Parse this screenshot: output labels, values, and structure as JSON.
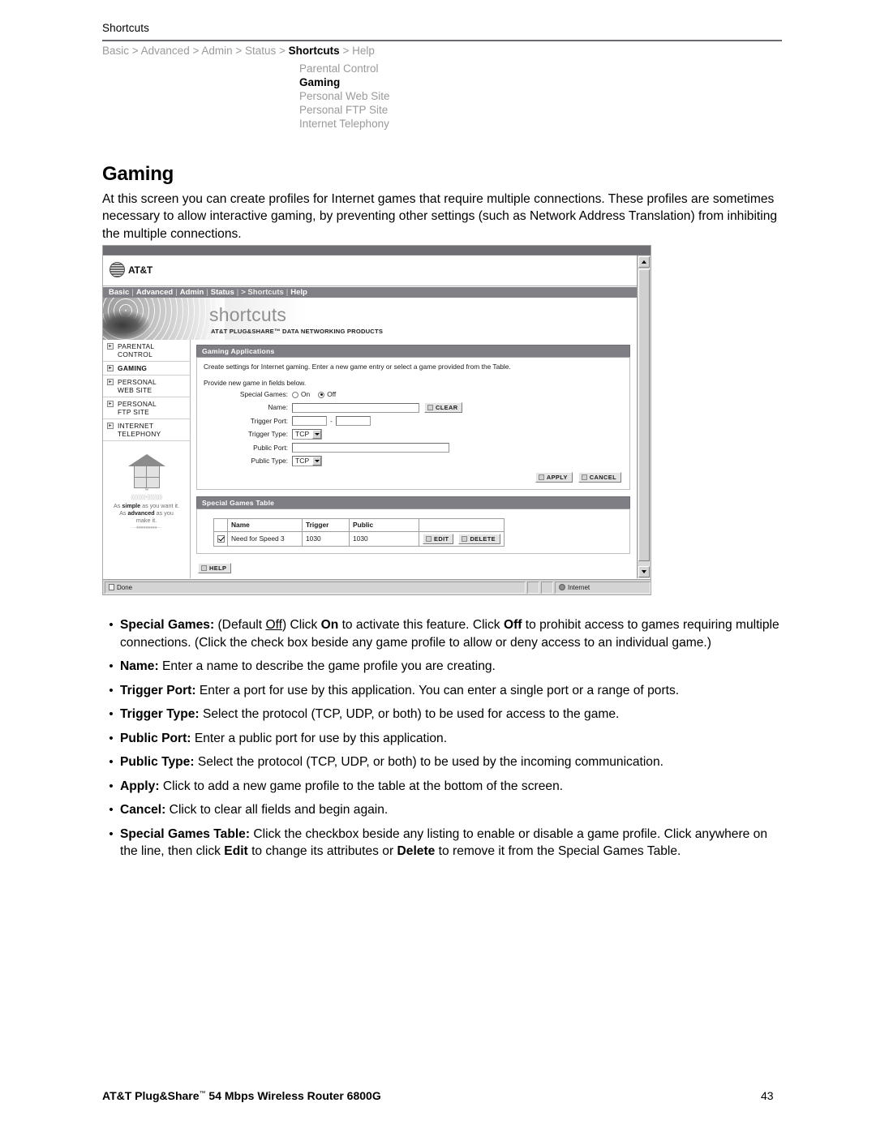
{
  "document": {
    "running_head": "Shortcuts",
    "breadcrumb": {
      "items": [
        "Basic",
        "Advanced",
        "Admin",
        "Status",
        "Shortcuts",
        "Help"
      ],
      "current": "Shortcuts",
      "separator": ">"
    },
    "sub_nav": {
      "items": [
        "Parental Control",
        "Gaming",
        "Personal Web Site",
        "Personal FTP Site",
        "Internet Telephony"
      ],
      "current": "Gaming"
    },
    "title": "Gaming",
    "intro": "At this screen you can create profiles for Internet games that require multiple connections. These profiles are sometimes necessary to allow interactive gaming, by preventing other settings (such as Network Address Translation) from inhibiting the multiple connections.",
    "footer": {
      "left": "AT&T Plug&Share",
      "left_tm": "™",
      "left_rest": " 54 Mbps Wireless Router 6800G",
      "page_number": "43"
    }
  },
  "screenshot": {
    "brand": {
      "logo_text": "AT&T",
      "banner_word": "shortcuts",
      "banner_subtitle": "AT&T PLUG&SHARE™ DATA NETWORKING PRODUCTS"
    },
    "nav": {
      "items": [
        "Basic",
        "Advanced",
        "Admin",
        "Status",
        "> Shortcuts",
        "Help"
      ],
      "current": "> Shortcuts"
    },
    "sidebar": {
      "items": [
        {
          "label_line1": "PARENTAL",
          "label_line2": "CONTROL",
          "current": false
        },
        {
          "label_line1": "GAMING",
          "label_line2": "",
          "current": true
        },
        {
          "label_line1": "PERSONAL",
          "label_line2": "WEB SITE",
          "current": false
        },
        {
          "label_line1": "PERSONAL",
          "label_line2": "FTP SITE",
          "current": false
        },
        {
          "label_line1": "INTERNET",
          "label_line2": "TELEPHONY",
          "current": false
        }
      ],
      "tagline_line1_pre": "As ",
      "tagline_line1_bold": "simple",
      "tagline_line1_post": " as you want it.",
      "tagline_line2_pre": "As ",
      "tagline_line2_bold": "advanced",
      "tagline_line2_post": " as you make it.",
      "tm": "™"
    },
    "applications_panel": {
      "heading": "Gaming Applications",
      "description": "Create settings for Internet gaming. Enter a new game entry or select a game provided from the Table.",
      "lead": "Provide new game in fields below.",
      "fields": {
        "special_games_label": "Special Games:",
        "special_games_on": "On",
        "special_games_off": "Off",
        "special_games_value": "Off",
        "name_label": "Name:",
        "name_value": "",
        "clear_button": "CLEAR",
        "trigger_port_label": "Trigger Port:",
        "trigger_port_from": "",
        "trigger_port_to": "",
        "trigger_port_dash": "-",
        "trigger_type_label": "Trigger Type:",
        "trigger_type_value": "TCP",
        "public_port_label": "Public Port:",
        "public_port_value": "",
        "public_type_label": "Public Type:",
        "public_type_value": "TCP"
      },
      "apply_button": "APPLY",
      "cancel_button": "CANCEL"
    },
    "games_table": {
      "heading": "Special Games Table",
      "columns": [
        "",
        "Name",
        "Trigger",
        "Public",
        ""
      ],
      "rows": [
        {
          "checked": true,
          "name": "Need for Speed 3",
          "trigger": "1030",
          "public": "1030",
          "edit_button": "EDIT",
          "delete_button": "DELETE"
        }
      ]
    },
    "help_button": "HELP",
    "status_bar": {
      "left": "Done",
      "zone": "Internet"
    }
  },
  "bullets": [
    {
      "term": "Special Games:",
      "parts": [
        {
          "t": " (Default "
        },
        {
          "t": "Off",
          "style": "u"
        },
        {
          "t": ") Click "
        },
        {
          "t": "On",
          "style": "b"
        },
        {
          "t": " to activate this feature. Click "
        },
        {
          "t": "Off",
          "style": "b"
        },
        {
          "t": " to prohibit access to games requiring multiple connections. (Click the check box beside any game profile to allow or deny access to an individual game.)"
        }
      ]
    },
    {
      "term": "Name:",
      "parts": [
        {
          "t": " Enter a name to describe the game profile you are creating."
        }
      ]
    },
    {
      "term": "Trigger Port:",
      "parts": [
        {
          "t": " Enter a port for use by this application. You can enter a single port or a range of ports."
        }
      ]
    },
    {
      "term": "Trigger Type:",
      "parts": [
        {
          "t": " Select the protocol (TCP, UDP, or both) to be used for access to the game."
        }
      ]
    },
    {
      "term": "Public Port:",
      "parts": [
        {
          "t": " Enter a public port for use by this application."
        }
      ]
    },
    {
      "term": "Public Type:",
      "parts": [
        {
          "t": " Select the protocol (TCP, UDP, or both) to be used by the incoming communication."
        }
      ]
    },
    {
      "term": "Apply:",
      "parts": [
        {
          "t": " Click to add a new game profile to the table at the bottom of the screen."
        }
      ]
    },
    {
      "term": "Cancel:",
      "parts": [
        {
          "t": " Click to clear all fields and begin again."
        }
      ]
    },
    {
      "term": "Special Games Table:",
      "parts": [
        {
          "t": " Click the checkbox beside any listing to enable or disable a game profile. Click anywhere on the line, then click "
        },
        {
          "t": "Edit",
          "style": "b"
        },
        {
          "t": " to change its attributes or "
        },
        {
          "t": "Delete",
          "style": "b"
        },
        {
          "t": " to remove it from the Special Games Table."
        }
      ]
    }
  ],
  "icons": {
    "bullet": "•",
    "scroll_up": "scroll-up-arrow",
    "scroll_down": "scroll-down-arrow"
  },
  "colors": {
    "rule": "#6b6b72",
    "muted_text": "#9a9a9a",
    "panel_header_bg": "#7e7e84",
    "navbar_bg": "#808086"
  }
}
